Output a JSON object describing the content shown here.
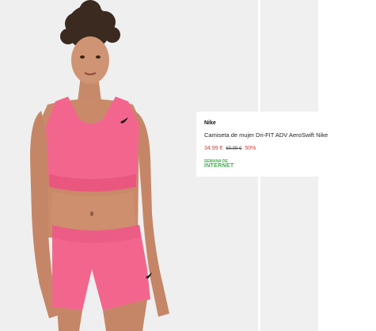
{
  "product": {
    "brand": "Nike",
    "title": "Camiseta de mujer Dri-FIT ADV AeroSwift Nike",
    "price_current": "34.99 €",
    "price_original": "69.99 €",
    "discount": "50%",
    "badge_line1": "SEMANA DE",
    "badge_line2": "INTERNET"
  },
  "colors": {
    "price_accent": "#d43b3b",
    "badge_green": "#3fae4a",
    "garment_pink": "#f2668e",
    "photo_background": "#efefef"
  }
}
